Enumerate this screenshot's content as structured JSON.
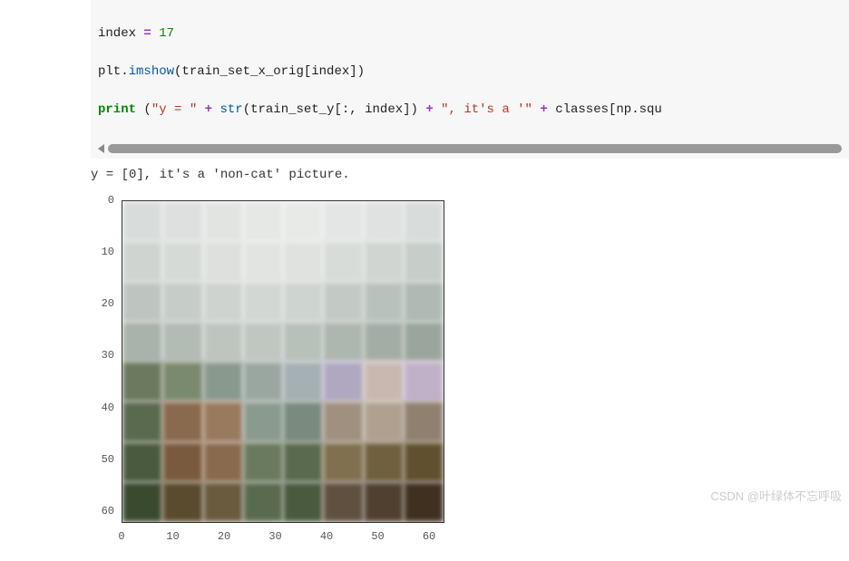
{
  "code": {
    "line1_a": "index ",
    "line1_eq": "= ",
    "line1_num": "17",
    "line2_a": "plt.",
    "line2_fn": "imshow",
    "line2_b": "(train_set_x_orig[index])",
    "line3_kw": "print",
    "line3_a": " (",
    "line3_s1": "\"y = \"",
    "line3_p1": " + ",
    "line3_fn": "str",
    "line3_b": "(train_set_y[:, index]) ",
    "line3_p2": "+ ",
    "line3_s2": "\", it's a '\"",
    "line3_p3": " + ",
    "line3_c": "classes[np.squ"
  },
  "output": {
    "text": "y = [0], it's a 'non-cat' picture."
  },
  "chart_data": {
    "type": "image",
    "description": "imshow of 64x64 RGB image (blurry cityscape / landscape, non-cat)",
    "y_ticks": [
      "0",
      "10",
      "20",
      "30",
      "40",
      "50",
      "60"
    ],
    "x_ticks": [
      "0",
      "10",
      "20",
      "30",
      "40",
      "50",
      "60"
    ],
    "xlim": [
      0,
      63
    ],
    "ylim": [
      63,
      0
    ]
  },
  "watermark": "CSDN @叶绿体不忘呼吸"
}
